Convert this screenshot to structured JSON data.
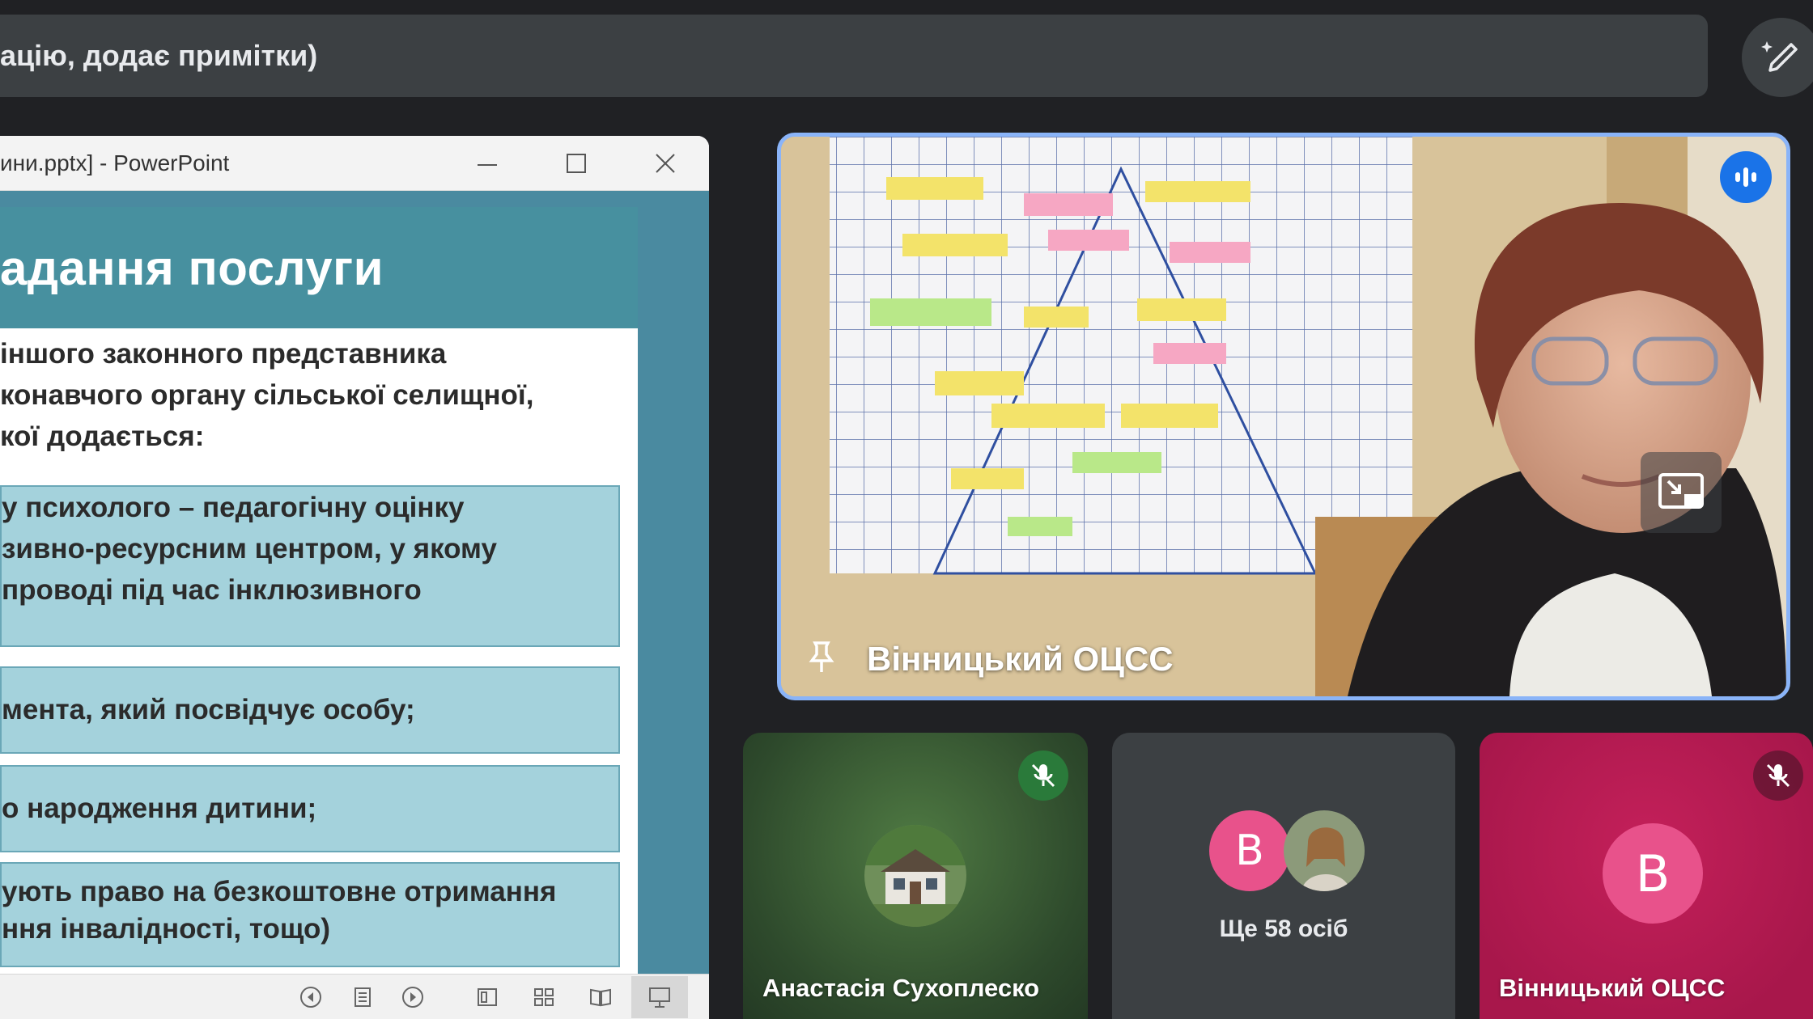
{
  "caption": {
    "text": "ацію, додає примітки)"
  },
  "powerpoint": {
    "window_title": "ини.pptx] - PowerPoint",
    "slide": {
      "title": "адання послуги",
      "intro_lines": [
        "іншого законного представника",
        "конавчого органу сільської  селищної,",
        "кої додається:"
      ],
      "boxes": [
        {
          "lines": [
            "у психолого – педагогічну оцінку",
            "зивно-ресурсним центром, у якому",
            "проводі під час інклюзивного"
          ]
        },
        {
          "lines": [
            "мента, який посвідчує особу;"
          ]
        },
        {
          "lines": [
            "о народження дитини;"
          ]
        },
        {
          "lines": [
            "ують право на безкоштовне отримання",
            "ння інвалідності, тощо)"
          ]
        }
      ]
    },
    "statusbar_icons": [
      "prev-icon",
      "notes-icon",
      "next-icon",
      "normal-view-icon",
      "slide-sorter-icon",
      "reading-view-icon",
      "slideshow-icon"
    ]
  },
  "main_speaker": {
    "name": "Вінницький ОЦСС"
  },
  "tiles": [
    {
      "name": "Анастасія Сухоплеско",
      "muted": true
    },
    {
      "avatar_letter": "В",
      "more_label": "Ще 58 осіб"
    },
    {
      "name": "Вінницький ОЦСС",
      "avatar_letter": "В",
      "muted": true
    }
  ],
  "colors": {
    "background": "#202124",
    "speaker_border": "#8ab4f8",
    "speaking_indicator": "#1a73e8",
    "slide_accent": "#47909f",
    "slide_box": "#a4d2dc",
    "avatar_pink": "#e8528b",
    "tile_magenta": "#a8174b",
    "mic_green": "#2a7a3a"
  }
}
